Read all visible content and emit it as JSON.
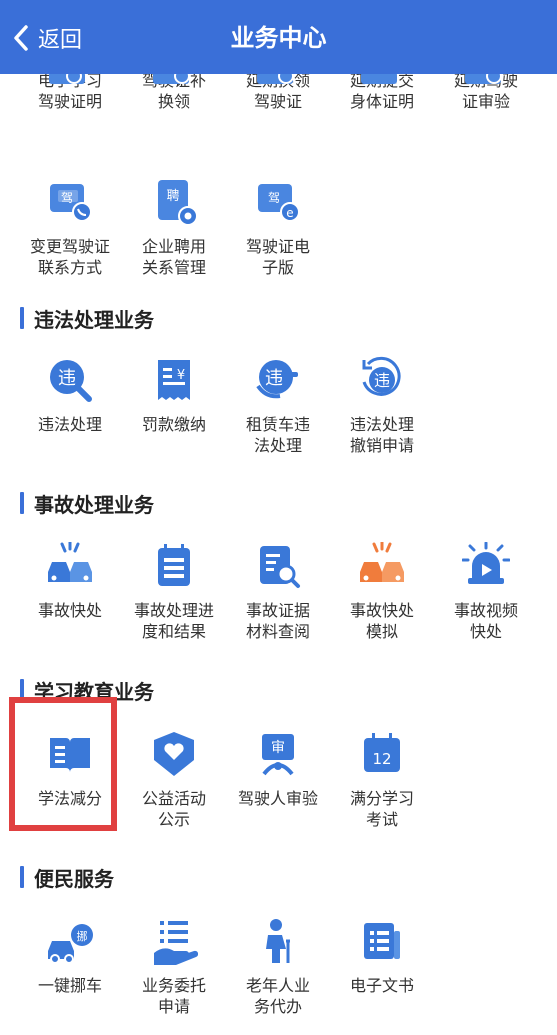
{
  "header": {
    "back_label": "返回",
    "title": "业务中心"
  },
  "sections": [
    {
      "title": "违法处理业务"
    },
    {
      "title": "事故处理业务"
    },
    {
      "title": "学习教育业务"
    },
    {
      "title": "便民服务"
    }
  ],
  "license_items": [
    {
      "label": "电子学习\n驾驶证明",
      "icon": "learning-certificate-icon"
    },
    {
      "label": "驾驶证补\n换领",
      "icon": "license-replace-icon"
    },
    {
      "label": "延期换领\n驾驶证",
      "icon": "license-extend-icon"
    },
    {
      "label": "延期提交\n身体证明",
      "icon": "health-proof-icon"
    },
    {
      "label": "延期驾驶\n证审验",
      "icon": "license-review-icon"
    },
    {
      "label": "变更驾驶证\n联系方式",
      "icon": "contact-change-icon",
      "glyph": "驾"
    },
    {
      "label": "企业聘用\n关系管理",
      "icon": "employment-icon",
      "glyph": "聘"
    },
    {
      "label": "驾驶证电\n子版",
      "icon": "e-license-icon",
      "glyph": "驾"
    }
  ],
  "violation_items": [
    {
      "label": "违法处理",
      "icon": "violation-icon",
      "glyph": "违"
    },
    {
      "label": "罚款缴纳",
      "icon": "fine-payment-icon",
      "glyph": "¥"
    },
    {
      "label": "租赁车违\n法处理",
      "icon": "rental-violation-icon",
      "glyph": "违"
    },
    {
      "label": "违法处理\n撤销申请",
      "icon": "violation-revoke-icon",
      "glyph": "违"
    }
  ],
  "accident_items": [
    {
      "label": "事故快处",
      "icon": "accident-quick-icon"
    },
    {
      "label": "事故处理进\n度和结果",
      "icon": "accident-progress-icon"
    },
    {
      "label": "事故证据\n材料查阅",
      "icon": "accident-evidence-icon"
    },
    {
      "label": "事故快处\n模拟",
      "icon": "accident-sim-icon"
    },
    {
      "label": "事故视频\n快处",
      "icon": "accident-video-icon"
    }
  ],
  "education_items": [
    {
      "label": "学法减分",
      "icon": "study-law-book-icon"
    },
    {
      "label": "公益活动\n公示",
      "icon": "charity-icon"
    },
    {
      "label": "驾驶人审验",
      "icon": "driver-review-icon",
      "glyph": "审"
    },
    {
      "label": "满分学习\n考试",
      "icon": "full-score-exam-icon",
      "glyph": "12"
    }
  ],
  "service_items": [
    {
      "label": "一键挪车",
      "icon": "move-car-icon",
      "glyph": "挪"
    },
    {
      "label": "业务委托\n申请",
      "icon": "entrust-icon"
    },
    {
      "label": "老年人业\n务代办",
      "icon": "elderly-icon"
    },
    {
      "label": "电子文书",
      "icon": "e-document-icon"
    }
  ],
  "colors": {
    "header": "#3a6fd8",
    "icon_blue": "#3a78d8",
    "icon_orange": "#f07c3c",
    "highlight": "#e04040"
  }
}
